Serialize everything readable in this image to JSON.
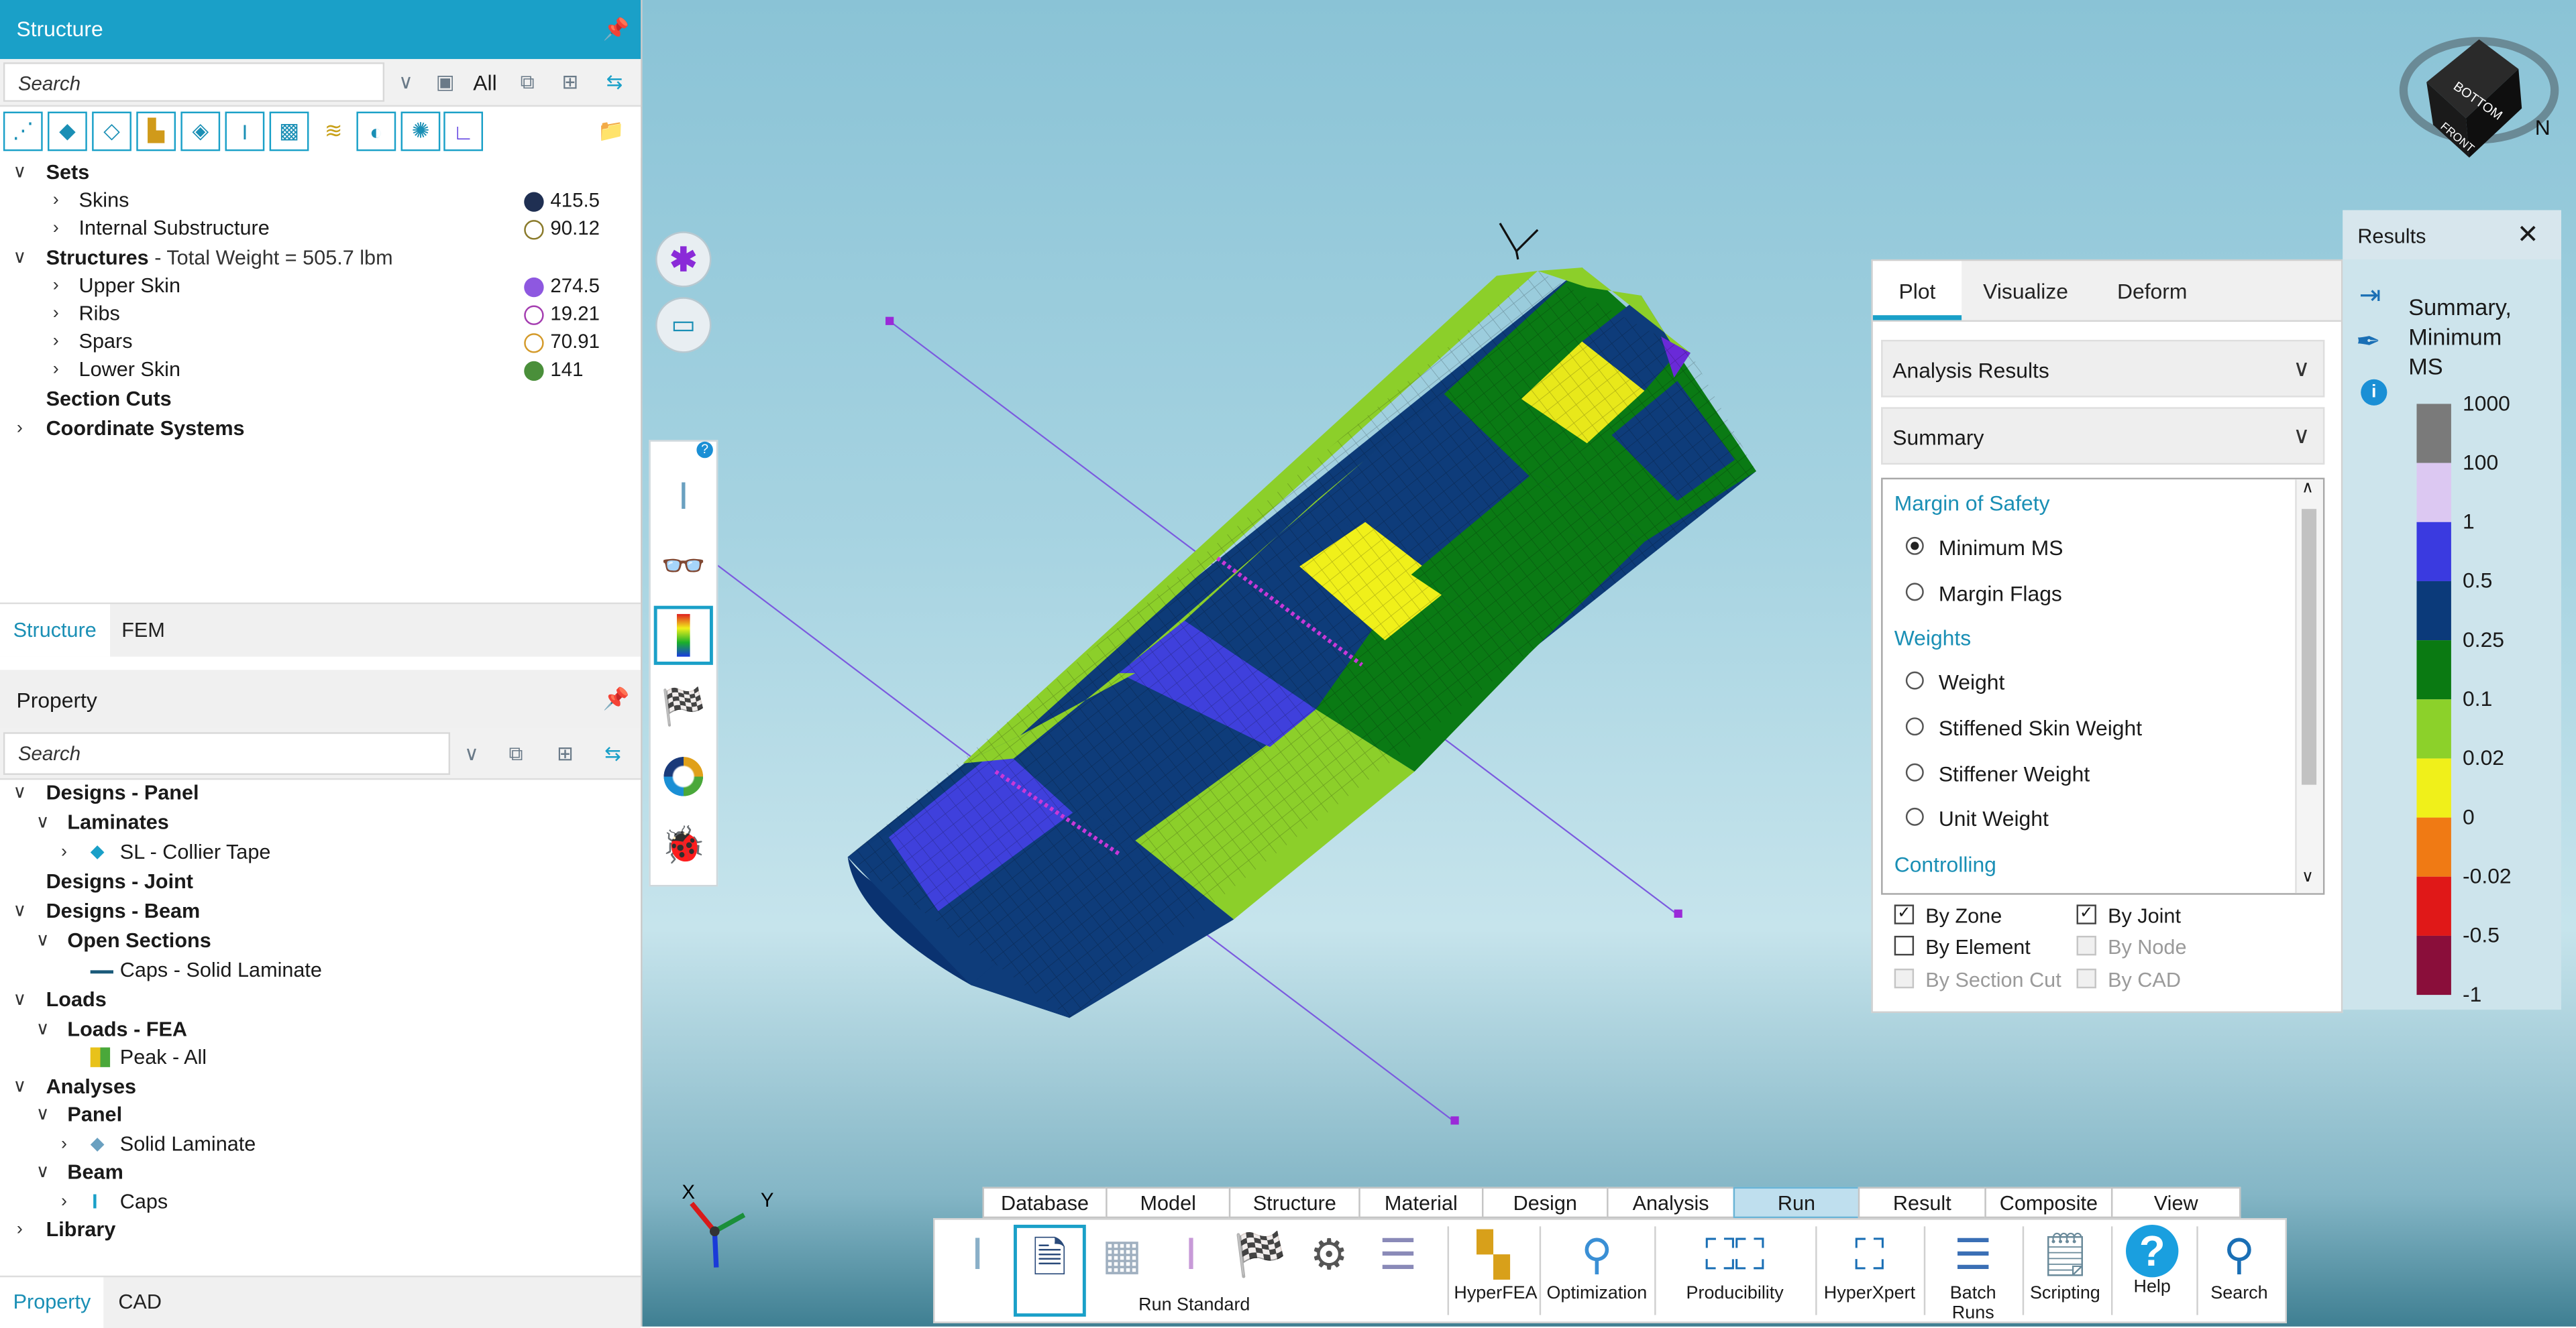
{
  "structure_panel": {
    "title": "Structure",
    "search_placeholder": "Search",
    "filter_value": "All",
    "tree": {
      "sets": {
        "label": "Sets",
        "items": [
          {
            "label": "Skins",
            "value": "415.5",
            "color": "#1f2f52"
          },
          {
            "label": "Internal Substructure",
            "value": "90.12",
            "color": "#8a7a2a"
          }
        ]
      },
      "structures": {
        "label": "Structures",
        "subtitle": " - Total Weight = 505.7 lbm",
        "items": [
          {
            "label": "Upper Skin",
            "value": "274.5",
            "color": "#8e58e0"
          },
          {
            "label": "Ribs",
            "value": "19.21",
            "color": "#a43cb0"
          },
          {
            "label": "Spars",
            "value": "70.91",
            "color": "#d49a2a"
          },
          {
            "label": "Lower Skin",
            "value": "141",
            "color": "#4a8f3a"
          }
        ]
      },
      "section_cuts": "Section Cuts",
      "coordinate_systems": "Coordinate Systems"
    },
    "tabs": [
      "Structure",
      "FEM"
    ]
  },
  "property_panel": {
    "title": "Property",
    "search_placeholder": "Search",
    "tree": {
      "designs_panel": "Designs - Panel",
      "laminates": "Laminates",
      "sl_collier": "SL - Collier Tape",
      "designs_joint": "Designs - Joint",
      "designs_beam": "Designs - Beam",
      "open_sections": "Open Sections",
      "caps_solid": "Caps - Solid Laminate",
      "loads": "Loads",
      "loads_fea": "Loads - FEA",
      "peak_all": "Peak - All",
      "analyses": "Analyses",
      "panel": "Panel",
      "solid_laminate": "Solid Laminate",
      "beam": "Beam",
      "caps": "Caps",
      "library": "Library"
    },
    "tabs": [
      "Property",
      "CAD"
    ]
  },
  "viewport": {
    "axis_labels": {
      "x": "X",
      "y": "Y"
    },
    "viewcube": {
      "top": "BOTTOM",
      "front": "FRONT",
      "compass": "N"
    }
  },
  "results_panel": {
    "tabs": [
      "Plot",
      "Visualize",
      "Deform"
    ],
    "dropdown1": "Analysis Results",
    "dropdown2": "Summary",
    "groups": {
      "margin": "Margin of Safety",
      "weights": "Weights",
      "controlling": "Controlling"
    },
    "options": {
      "minimum_ms": "Minimum MS",
      "margin_flags": "Margin Flags",
      "weight": "Weight",
      "stiffened_skin_weight": "Stiffened Skin Weight",
      "stiffener_weight": "Stiffener Weight",
      "unit_weight": "Unit Weight"
    },
    "selected_option": "Minimum MS",
    "checkboxes": {
      "by_zone": "By Zone",
      "by_joint": "By Joint",
      "by_element": "By Element",
      "by_node": "By Node",
      "by_section_cut": "By Section Cut",
      "by_cad": "By CAD"
    },
    "checked": [
      "By Zone",
      "By Joint"
    ]
  },
  "legend": {
    "header": "Results",
    "title": [
      "Summary,",
      "Minimum",
      "MS"
    ],
    "levels": [
      "1000",
      "100",
      "1",
      "0.5",
      "0.25",
      "0.1",
      "0.02",
      "0",
      "-0.02",
      "-0.5",
      "-1"
    ],
    "colors": [
      "#7a7a7a",
      "#dcc8f2",
      "#3a3ae0",
      "#0b3a7a",
      "#0a7a12",
      "#8cd12a",
      "#f0f01a",
      "#f07a14",
      "#e01818",
      "#8a0e3a"
    ]
  },
  "ribbon": {
    "tabs": [
      "Database",
      "Model",
      "Structure",
      "Material",
      "Design",
      "Analysis",
      "Run",
      "Result",
      "Composite",
      "View"
    ],
    "active_tab": "Run",
    "buttons": {
      "run_standard": "Run Standard",
      "hyperfea": "HyperFEA",
      "optimization": "Optimization",
      "producibility": "Producibility",
      "hyperxpert": "HyperXpert",
      "batch_runs": "Batch Runs",
      "scripting": "Scripting",
      "help": "Help",
      "search": "Search"
    }
  }
}
